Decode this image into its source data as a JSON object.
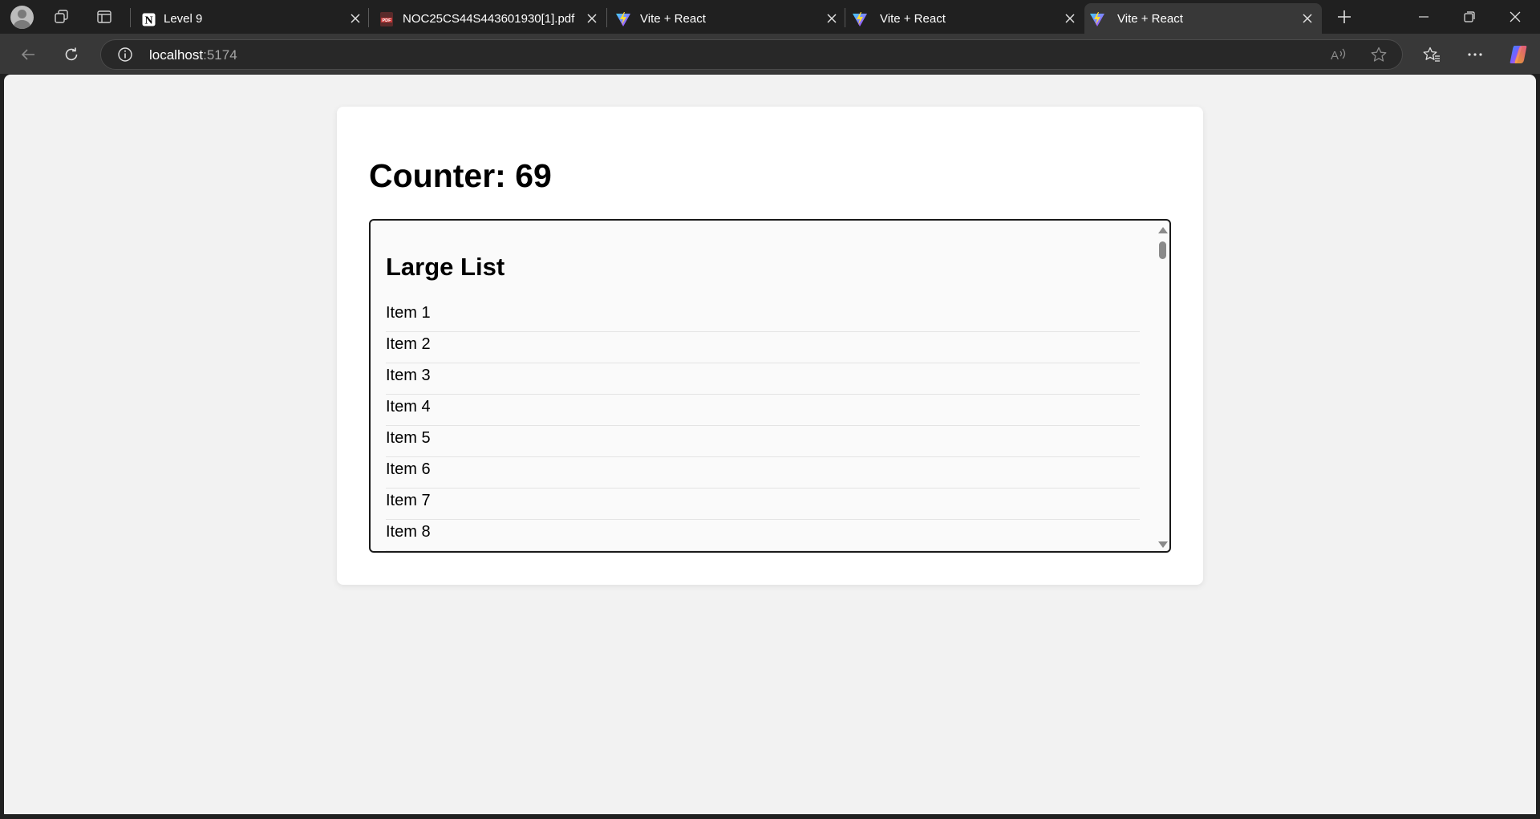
{
  "browser": {
    "tabs": [
      {
        "title": "Level 9",
        "favicon": "notion-icon",
        "active": false
      },
      {
        "title": "NOC25CS44S443601930[1].pdf",
        "favicon": "pdf-icon",
        "active": false
      },
      {
        "title": "Vite + React",
        "favicon": "vite-icon",
        "active": false
      },
      {
        "title": "Vite + React",
        "favicon": "vite-icon",
        "active": false
      },
      {
        "title": "Vite + React",
        "favicon": "vite-icon",
        "active": true
      }
    ],
    "address": {
      "host": "localhost",
      "port": ":5174"
    },
    "colors": {
      "tabstrip": "#202020",
      "toolbar": "#383838",
      "viewport": "#f2f2f2"
    }
  },
  "page": {
    "counter_label": "Counter: 69",
    "list_title": "Large List",
    "items": [
      "Item 1",
      "Item 2",
      "Item 3",
      "Item 4",
      "Item 5",
      "Item 6",
      "Item 7",
      "Item 8"
    ]
  }
}
